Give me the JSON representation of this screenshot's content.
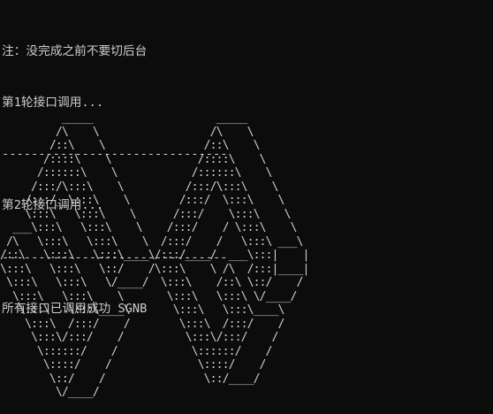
{
  "console": {
    "lines": [
      "注：没完成之前不要切后台",
      "第1轮接口调用...",
      "-------------------------------",
      "第2轮接口调用...",
      "-------------------------------",
      "所有接口已调用成功 SGNB"
    ]
  },
  "ascii_art": {
    "text": "          _____                    _____\n         /\\    \\                  /\\    \\\n        /::\\    \\                /::\\    \\\n       /::::\\    \\              /::::\\    \\\n      /::::::\\    \\            /::::::\\    \\\n     /:::/\\:::\\    \\          /:::/\\:::\\    \\\n    /:::/__\\:::\\    \\        /:::/  \\:::\\    \\\n    \\:::\\   \\:::\\    \\      /:::/    \\:::\\    \\\n  ___\\:::\\   \\:::\\    \\    /:::/    / \\:::\\    \\\n /\\   \\:::\\   \\:::\\    \\  /:::/    /   \\:::\\ ___\\\n/::\\   \\:::\\   \\:::\\____\\/:::/____/  ___\\:::|    |\n\\:::\\   \\:::\\   \\::/    /\\:::\\    \\ /\\  /:::|____|\n \\:::\\   \\:::\\   \\/____/  \\:::\\    /::\\ \\::/    /\n  \\:::\\   \\:::\\    \\       \\:::\\   \\:::\\ \\/____/\n   \\:::\\   \\:::\\____\\       \\:::\\   \\:::\\____\\\n    \\:::\\  /:::/    /        \\:::\\  /:::/    /\n     \\:::\\/:::/    /          \\:::\\/:::/    /\n      \\::::::/    /            \\::::::/    /\n       \\::::/    /              \\::::/    /\n        \\::/    /                \\::/____/\n         \\/____/"
  }
}
